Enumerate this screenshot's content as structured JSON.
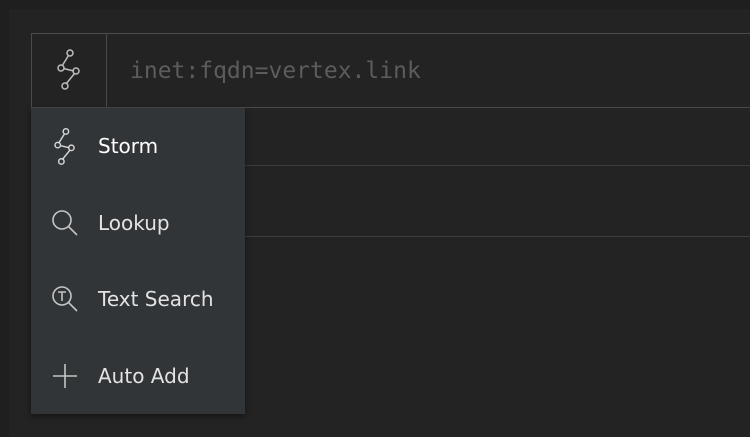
{
  "query_bar": {
    "mode_icon": "storm-icon",
    "placeholder": "inet:fqdn=vertex.link",
    "value": ""
  },
  "mode_menu": {
    "items": [
      {
        "label": "Storm",
        "icon": "storm-icon",
        "active": true
      },
      {
        "label": "Lookup",
        "icon": "magnifier-icon",
        "active": false
      },
      {
        "label": "Text Search",
        "icon": "text-search-icon",
        "active": false
      },
      {
        "label": "Auto Add",
        "icon": "plus-icon",
        "active": false
      }
    ]
  },
  "colors": {
    "background": "#1f1f1f",
    "panel": "#232323",
    "menu": "#313538",
    "border": "#4a4a4a",
    "placeholder_text": "#5c5c5c",
    "menu_text": "#e3e3e3",
    "icon": "#bdbdbd"
  }
}
